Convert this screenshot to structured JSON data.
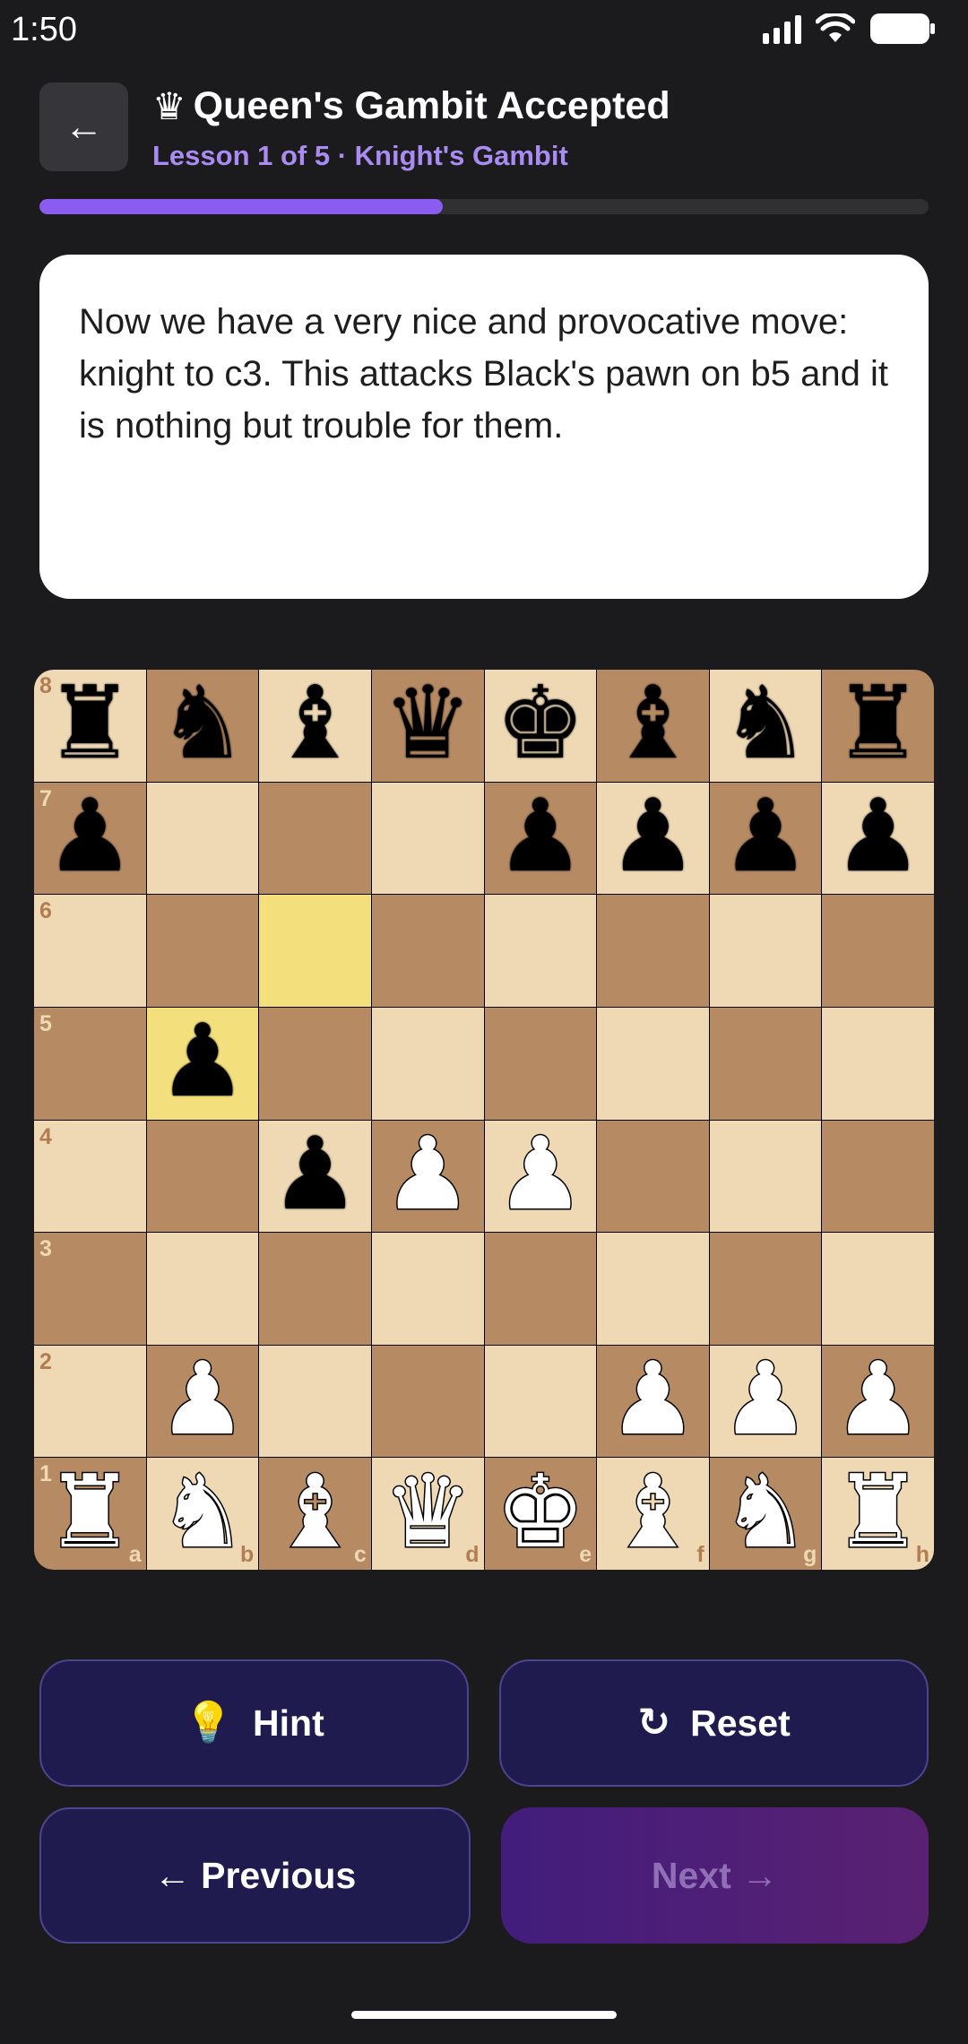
{
  "status_bar": {
    "time": "1:50"
  },
  "header": {
    "back_label": "←",
    "crown": "♛",
    "title": "Queen's Gambit Accepted",
    "subtitle": "Lesson 1 of 5 · Knight's Gambit"
  },
  "progress": {
    "value": 0.454
  },
  "lesson": {
    "text": "Now we have a very nice and provocative move: knight to c3. This attacks Black's pawn on b5 and it is nothing but trouble for them."
  },
  "board": {
    "ranks": [
      "8",
      "7",
      "6",
      "5",
      "4",
      "3",
      "2",
      "1"
    ],
    "files": [
      "a",
      "b",
      "c",
      "d",
      "e",
      "f",
      "g",
      "h"
    ],
    "position": [
      [
        "br",
        "bn",
        "bb",
        "bq",
        "bk",
        "bb",
        "bn",
        "br"
      ],
      [
        "bp",
        "",
        "",
        "",
        "bp",
        "bp",
        "bp",
        "bp"
      ],
      [
        "",
        "",
        "",
        "",
        "",
        "",
        "",
        ""
      ],
      [
        "",
        "bp",
        "",
        "",
        "",
        "",
        "",
        ""
      ],
      [
        "",
        "",
        "bp",
        "wp",
        "wp",
        "",
        "",
        ""
      ],
      [
        "",
        "",
        "",
        "",
        "",
        "",
        "",
        ""
      ],
      [
        "",
        "wp",
        "",
        "",
        "",
        "wp",
        "wp",
        "wp"
      ],
      [
        "wr",
        "wn",
        "wb",
        "wq",
        "wk",
        "wb",
        "wn",
        "wr"
      ]
    ],
    "highlighted": [
      "c6",
      "b5"
    ],
    "light_color": "#efd9b4",
    "dark_color": "#b68a62",
    "highlight_color": "#f3e07d"
  },
  "buttons": {
    "hint": {
      "icon": "💡",
      "label": "Hint"
    },
    "reset": {
      "icon": "↻",
      "label": "Reset"
    },
    "previous": {
      "label": "← Previous"
    },
    "next": {
      "label": "Next →"
    }
  },
  "colors": {
    "accent": "#8a5cf0",
    "subtitle": "#a98bf2",
    "button_bg": "#201b4e"
  }
}
